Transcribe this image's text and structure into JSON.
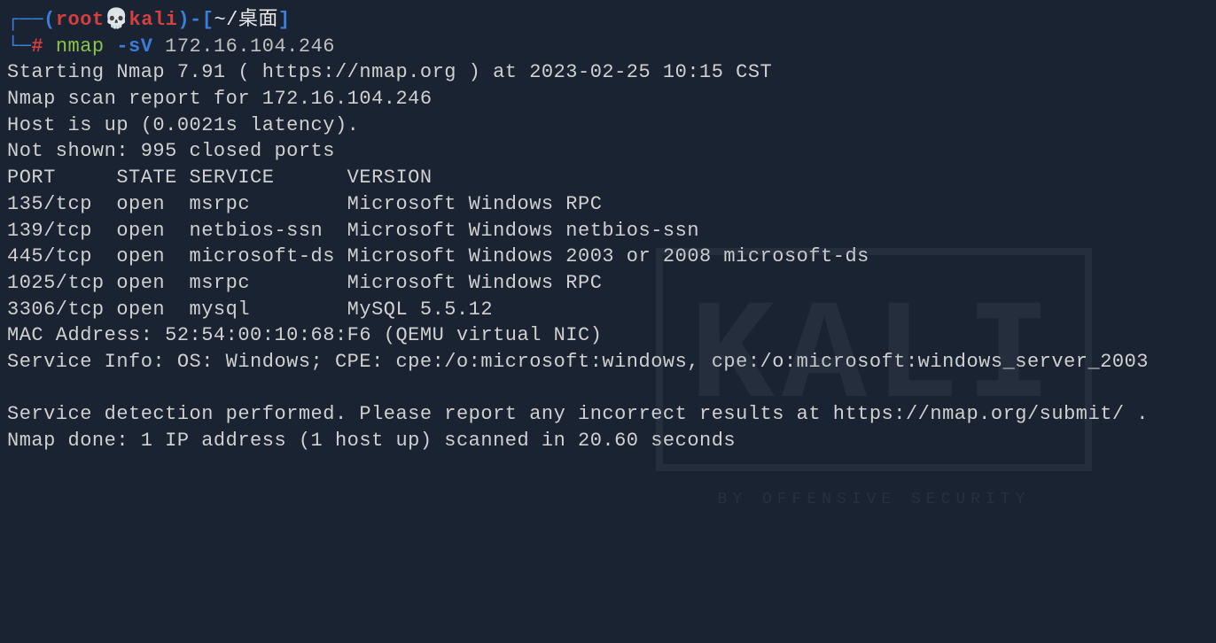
{
  "prompt": {
    "user": "root",
    "host": "kali",
    "skull": "💀",
    "path": "~/桌面",
    "symbol": "#",
    "command": "nmap",
    "args": "-sV",
    "target": "172.16.104.246"
  },
  "output": {
    "starting": "Starting Nmap 7.91 ( https://nmap.org ) at 2023-02-25 10:15 CST",
    "report": "Nmap scan report for 172.16.104.246",
    "host_up": "Host is up (0.0021s latency).",
    "not_shown": "Not shown: 995 closed ports",
    "table_header": "PORT     STATE SERVICE      VERSION",
    "ports": [
      "135/tcp  open  msrpc        Microsoft Windows RPC",
      "139/tcp  open  netbios-ssn  Microsoft Windows netbios-ssn",
      "445/tcp  open  microsoft-ds Microsoft Windows 2003 or 2008 microsoft-ds",
      "1025/tcp open  msrpc        Microsoft Windows RPC",
      "3306/tcp open  mysql        MySQL 5.5.12"
    ],
    "mac": "MAC Address: 52:54:00:10:68:F6 (QEMU virtual NIC)",
    "service_info": "Service Info: OS: Windows; CPE: cpe:/o:microsoft:windows, cpe:/o:microsoft:windows_server_2003",
    "blank": " ",
    "detection": "Service detection performed. Please report any incorrect results at https://nmap.org/submit/ .",
    "done": "Nmap done: 1 IP address (1 host up) scanned in 20.60 seconds"
  },
  "watermark": {
    "logo": "KALI",
    "sub": "BY OFFENSIVE SECURITY"
  }
}
